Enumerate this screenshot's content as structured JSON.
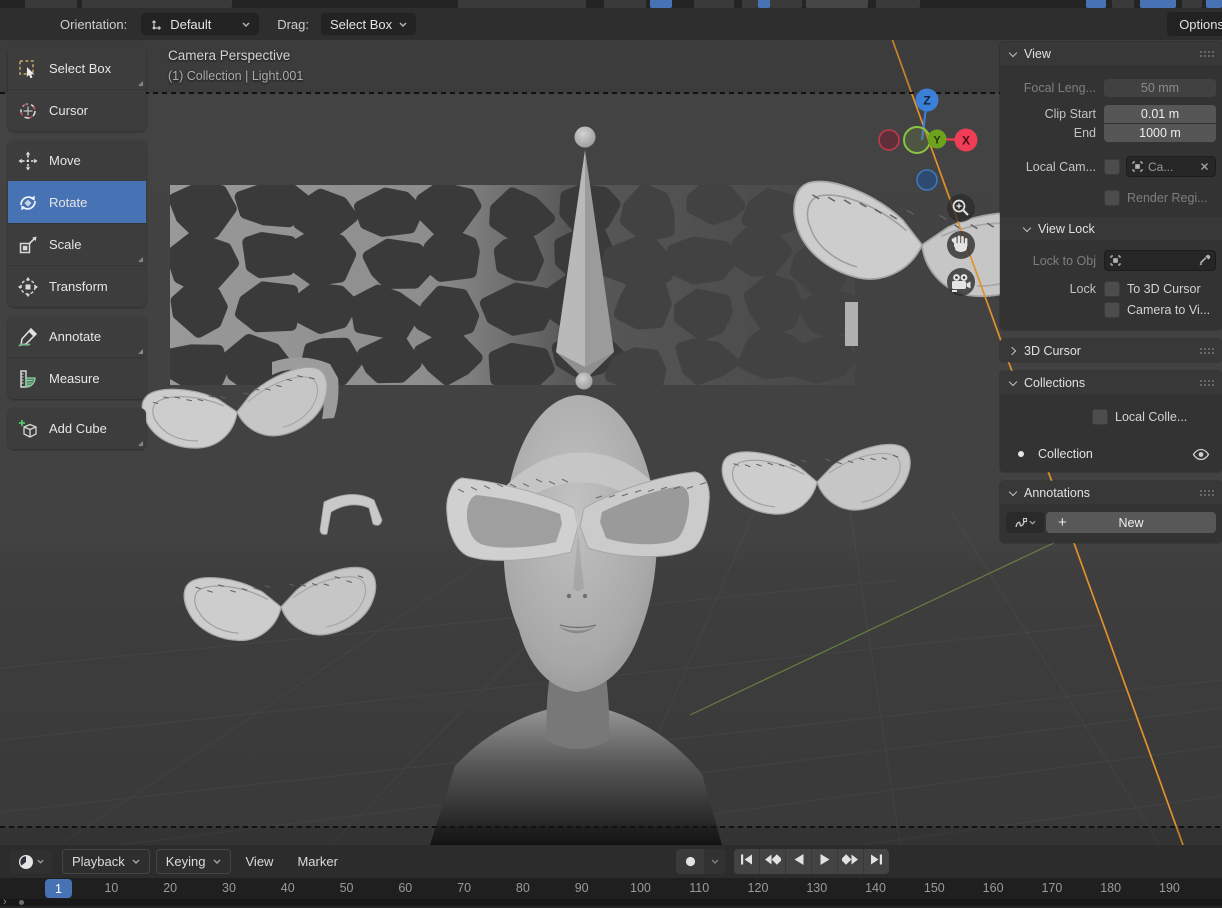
{
  "topbar": {
    "orientation_label": "Orientation:",
    "orientation_value": "Default",
    "drag_label": "Drag:",
    "drag_value": "Select Box",
    "options_label": "Options"
  },
  "viewport": {
    "view_label": "Camera Perspective",
    "scene_label": "(1) Collection | Light.001",
    "gizmo_axes": {
      "x": "X",
      "y": "Y",
      "z": "Z"
    }
  },
  "toolbar": {
    "groups": [
      [
        "select-box",
        "cursor"
      ],
      [
        "move",
        "rotate",
        "scale",
        "transform"
      ],
      [
        "annotate",
        "measure"
      ],
      [
        "add-cube"
      ]
    ],
    "tools": {
      "select-box": {
        "label": "Select Box",
        "icon": "select-box-icon",
        "selected": false,
        "has_subtools": true
      },
      "cursor": {
        "label": "Cursor",
        "icon": "cursor-icon",
        "selected": false,
        "has_subtools": false
      },
      "move": {
        "label": "Move",
        "icon": "move-icon",
        "selected": false,
        "has_subtools": false
      },
      "rotate": {
        "label": "Rotate",
        "icon": "rotate-icon",
        "selected": true,
        "has_subtools": false
      },
      "scale": {
        "label": "Scale",
        "icon": "scale-icon",
        "selected": false,
        "has_subtools": true
      },
      "transform": {
        "label": "Transform",
        "icon": "transform-icon",
        "selected": false,
        "has_subtools": false
      },
      "annotate": {
        "label": "Annotate",
        "icon": "annotate-icon",
        "selected": false,
        "has_subtools": true
      },
      "measure": {
        "label": "Measure",
        "icon": "measure-icon",
        "selected": false,
        "has_subtools": false
      },
      "add-cube": {
        "label": "Add Cube",
        "icon": "add-cube-icon",
        "selected": false,
        "has_subtools": true
      }
    }
  },
  "sidebar": {
    "view_panel": {
      "title": "View",
      "focal_label": "Focal Leng...",
      "focal_value": "50 mm",
      "clip_start_label": "Clip Start",
      "clip_start_value": "0.01 m",
      "clip_end_label": "End",
      "clip_end_value": "1000 m",
      "local_camera_label": "Local Cam...",
      "local_camera_value": "Ca...",
      "render_region_label": "Render Regi..."
    },
    "view_lock": {
      "title": "View Lock",
      "lock_to_obj_label": "Lock to Obj",
      "lock_label": "Lock",
      "to_3d_cursor_label": "To 3D Cursor",
      "camera_to_view_label": "Camera to Vi..."
    },
    "cursor_panel": {
      "title": "3D Cursor"
    },
    "collections_panel": {
      "title": "Collections",
      "local_collections_label": "Local Colle...",
      "collection_name": "Collection"
    },
    "annotations_panel": {
      "title": "Annotations",
      "new_label": "New"
    }
  },
  "timeline": {
    "menus": [
      {
        "id": "playback",
        "label": "Playback",
        "pill": true
      },
      {
        "id": "keying",
        "label": "Keying",
        "pill": true
      },
      {
        "id": "view",
        "label": "View",
        "pill": false
      },
      {
        "id": "marker",
        "label": "Marker",
        "pill": false
      }
    ],
    "transport": [
      "jump-to-start",
      "previous-keyframe",
      "play-reverse",
      "play",
      "next-keyframe",
      "jump-to-end"
    ],
    "current_frame": "1",
    "ticks": [
      "10",
      "20",
      "30",
      "40",
      "50",
      "60",
      "70",
      "80",
      "90",
      "100",
      "110",
      "120",
      "130",
      "140",
      "150",
      "160",
      "170",
      "180",
      "190"
    ]
  },
  "colors": {
    "accent": "#4772b3",
    "axis_x": "#ee3d55",
    "axis_y": "#6fa21c",
    "axis_z": "#3b7fd6",
    "light_line": "#e0912d",
    "annotate_green": "#6fbf8f"
  }
}
